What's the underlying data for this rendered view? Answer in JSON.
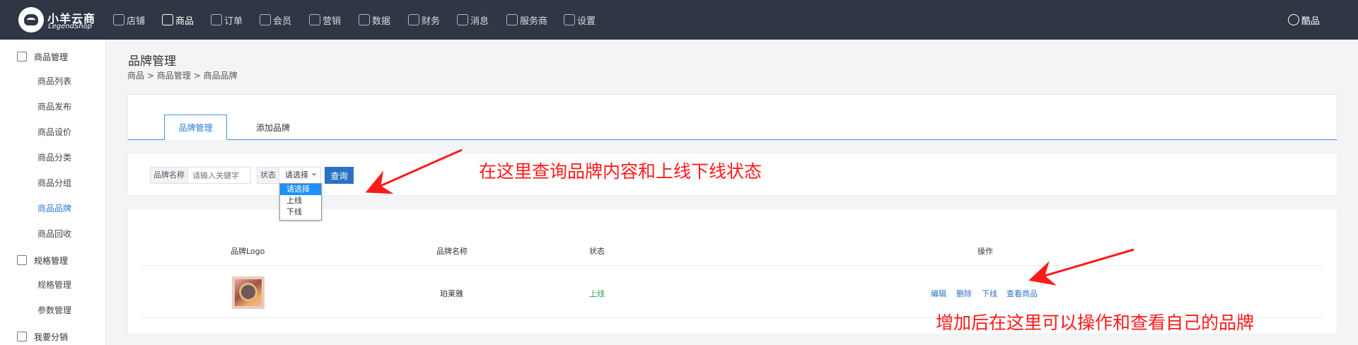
{
  "topbar": {
    "logo": {
      "cn": "小羊云商",
      "en": "LegendShop"
    },
    "nav": [
      {
        "label": "店铺",
        "icon": "house-icon"
      },
      {
        "label": "商品",
        "icon": "shopping-bag-icon",
        "active": true
      },
      {
        "label": "订单",
        "icon": "truck-icon"
      },
      {
        "label": "会员",
        "icon": "person-icon"
      },
      {
        "label": "营销",
        "icon": "balloon-icon"
      },
      {
        "label": "数据",
        "icon": "chart-doc-icon"
      },
      {
        "label": "财务",
        "icon": "money-bag-icon"
      },
      {
        "label": "消息",
        "icon": "message-icon"
      },
      {
        "label": "服务商",
        "icon": "building-icon"
      },
      {
        "label": "设置",
        "icon": "gear-icon"
      }
    ],
    "user": "酷品"
  },
  "sidebar": {
    "groups": [
      {
        "label": "商品管理",
        "icon": "shopping-bag-icon",
        "items": [
          "商品列表",
          "商品发布",
          "商品设价",
          "商品分类",
          "商品分组",
          "商品品牌",
          "商品回收"
        ],
        "active_item": "商品品牌"
      },
      {
        "label": "规格管理",
        "icon": "layers-icon",
        "items": [
          "规格管理",
          "参数管理"
        ]
      },
      {
        "label": "我要分销",
        "icon": "distribution-icon",
        "items": []
      }
    ]
  },
  "page": {
    "title": "品牌管理",
    "breadcrumb": [
      "商品",
      "商品管理",
      "商品品牌"
    ],
    "tabs": [
      {
        "label": "品牌管理",
        "active": true
      },
      {
        "label": "添加品牌",
        "active": false
      }
    ]
  },
  "filters": {
    "brand_name_label": "品牌名称",
    "brand_name_placeholder": "请输入关键字",
    "status_label": "状态",
    "status_selected": "请选择",
    "status_options": [
      "请选择",
      "上线",
      "下线"
    ],
    "query_button": "查询"
  },
  "table": {
    "headers": [
      "品牌Logo",
      "品牌名称",
      "状态",
      "操作"
    ],
    "rows": [
      {
        "logo": "brand-logo-image",
        "name": "珀莱雅",
        "status": "上线",
        "actions": [
          "编辑",
          "删除",
          "下线",
          "查看商品"
        ]
      }
    ]
  },
  "annotations": {
    "query": "在这里查询品牌内容和上线下线状态",
    "operate": "增加后在这里可以操作和查看自己的品牌"
  },
  "colors": {
    "topbar": "#2f3744",
    "primary": "#2b73c2",
    "online": "#2aa44f",
    "annotation": "#ff1a1a"
  }
}
